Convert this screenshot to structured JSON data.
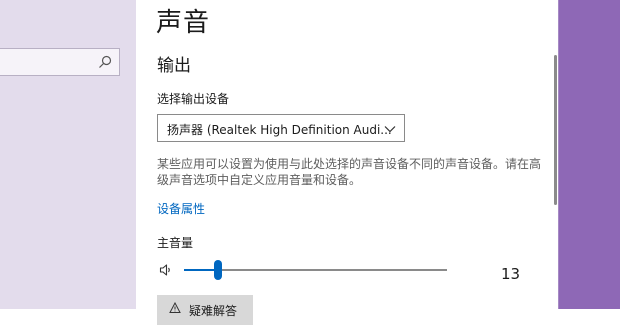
{
  "page": {
    "title": "声音",
    "section_title": "输出"
  },
  "output": {
    "device_label": "选择输出设备",
    "device_selected": "扬声器 (Realtek High Definition Audi...",
    "description": "某些应用可以设置为使用与此处选择的声音设备不同的声音设备。请在高级声音选项中自定义应用音量和设备。",
    "device_properties_link": "设备属性",
    "master_volume_label": "主音量",
    "volume_value": "13",
    "volume_fraction": 0.13,
    "troubleshoot_label": "疑难解答"
  },
  "icons": {
    "search": "search-icon",
    "dropdown": "chevron-down-icon",
    "speaker": "speaker-icon",
    "warning": "warning-icon"
  },
  "colors": {
    "accent": "#0067c0",
    "left_pane": "#e3dcec",
    "right_pane": "#8e68b6"
  }
}
